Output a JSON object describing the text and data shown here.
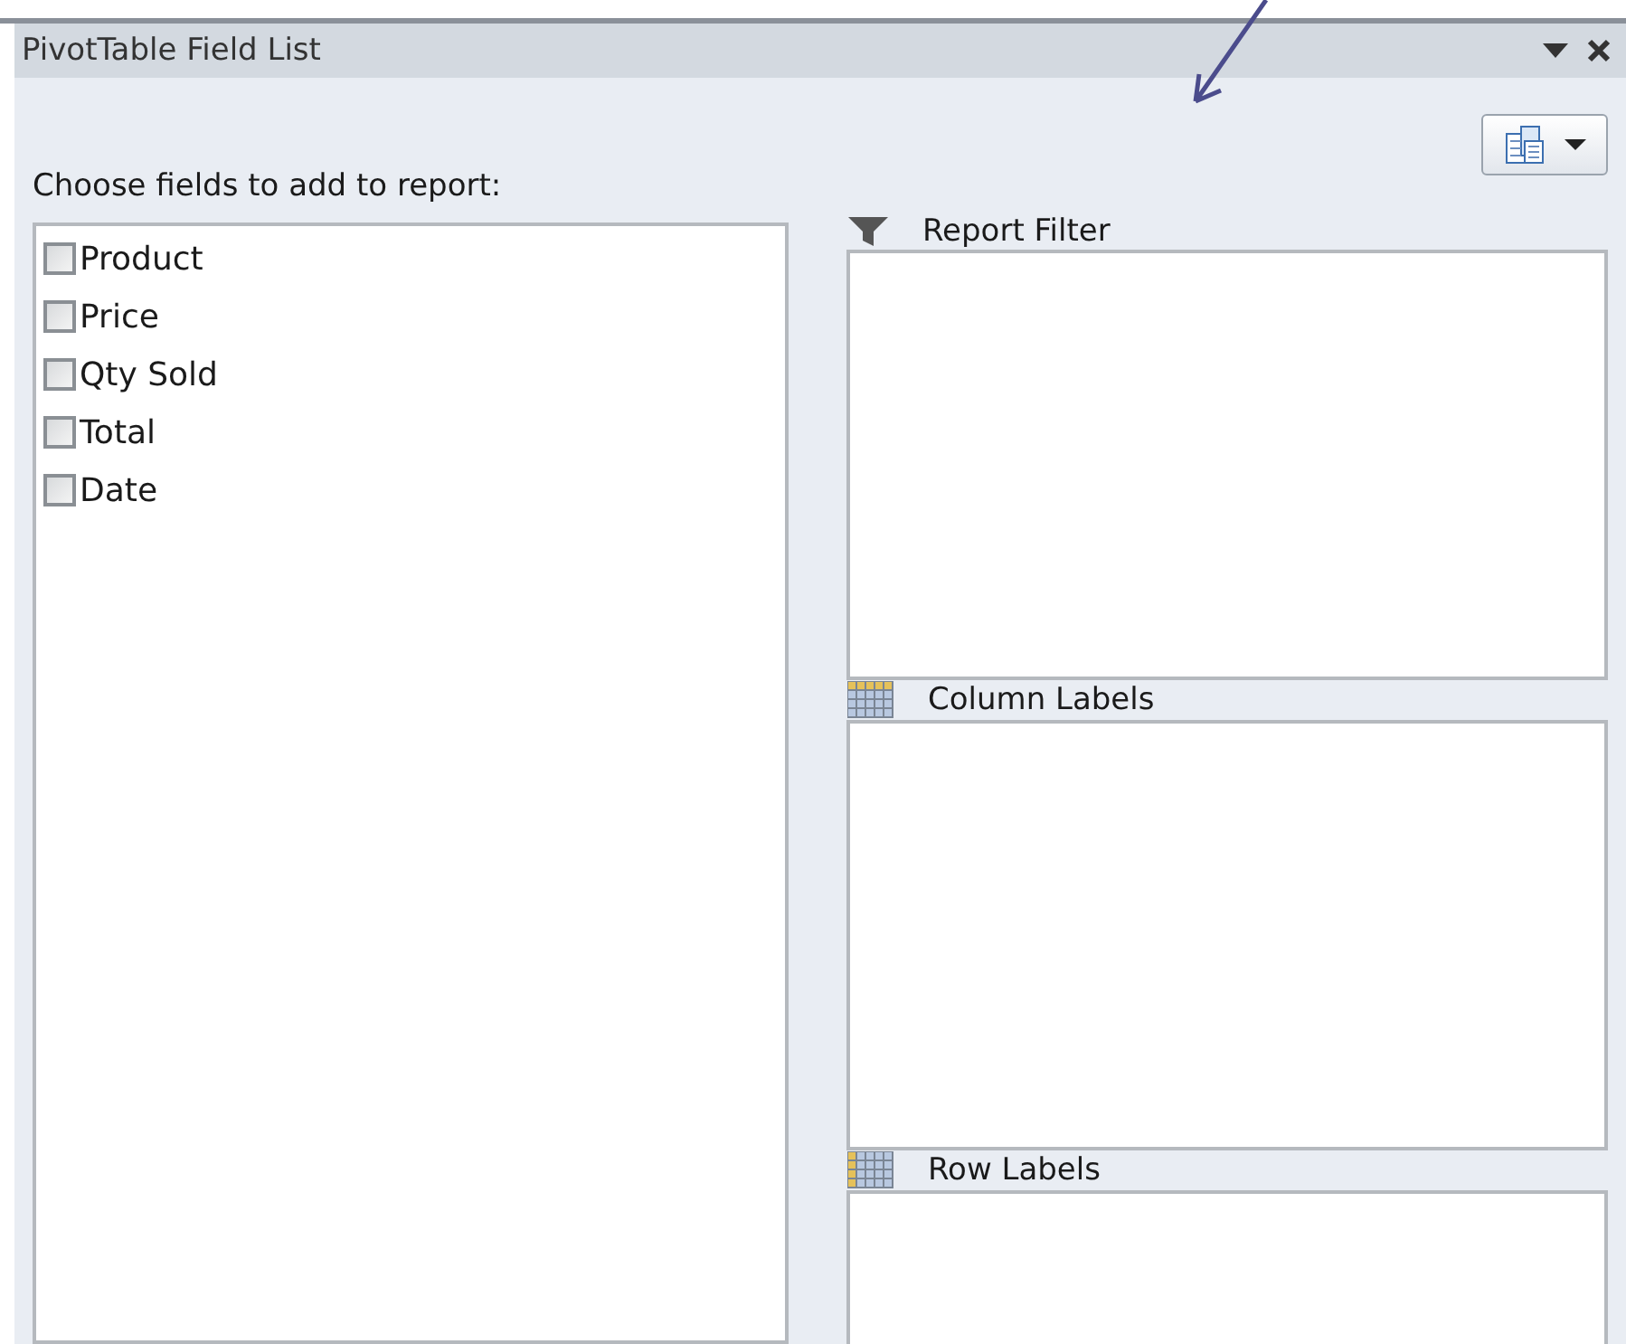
{
  "window": {
    "title": "PivotTable Field List"
  },
  "prompt": "Choose fields to add to report:",
  "fields": [
    {
      "name": "Product",
      "checked": false
    },
    {
      "name": "Price",
      "checked": false
    },
    {
      "name": "Qty Sold",
      "checked": false
    },
    {
      "name": "Total",
      "checked": false
    },
    {
      "name": "Date",
      "checked": false
    }
  ],
  "areas": [
    {
      "kind": "filter",
      "label": "Report Filter"
    },
    {
      "kind": "column",
      "label": "Column Labels"
    },
    {
      "kind": "row",
      "label": "Row Labels"
    }
  ]
}
